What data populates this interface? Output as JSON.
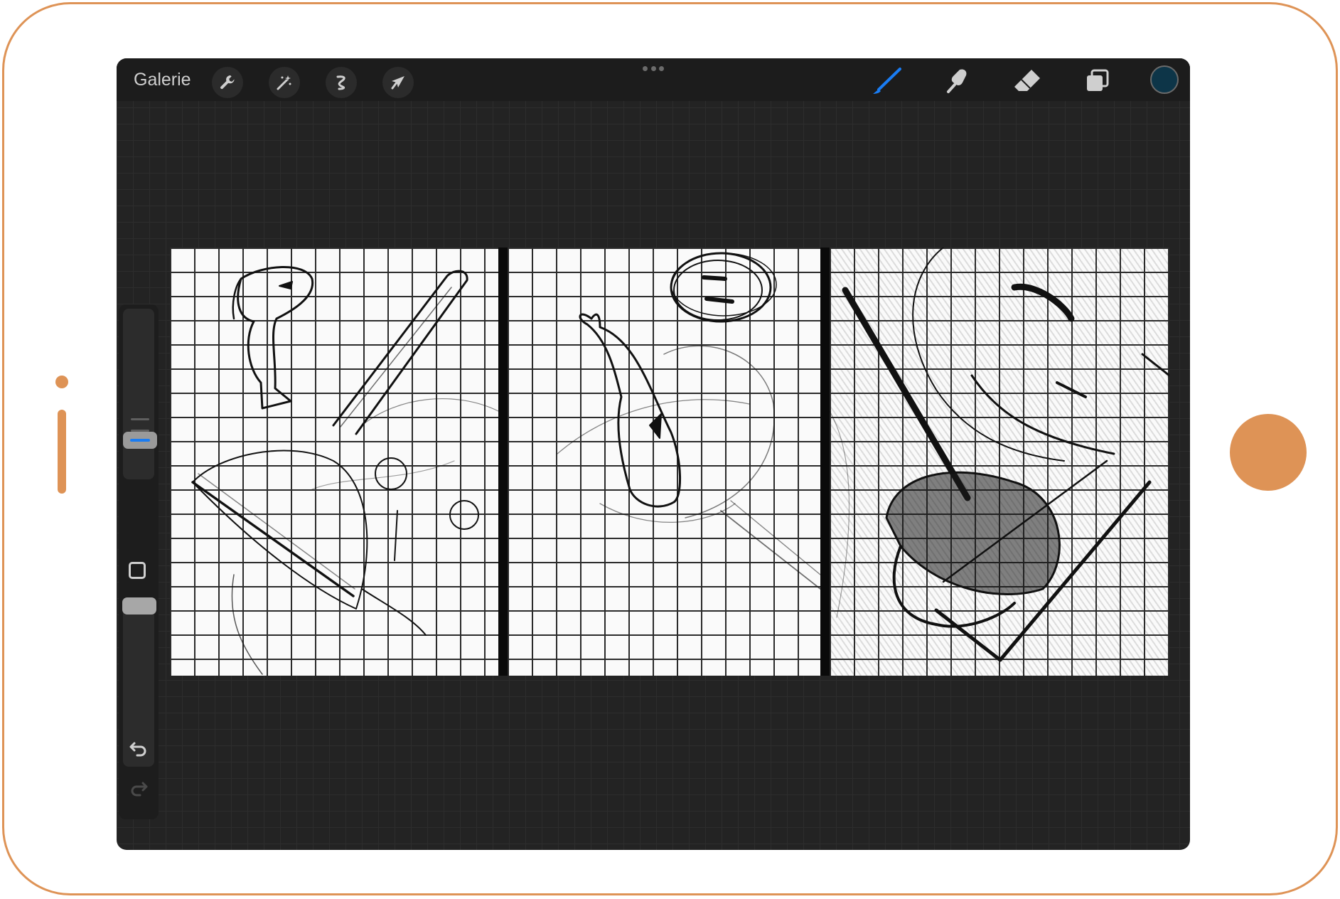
{
  "toolbar": {
    "gallery_label": "Galerie",
    "left_tools": [
      "wrench-icon",
      "magic-wand-icon",
      "selection-icon",
      "transform-arrow-icon"
    ],
    "right_tools": [
      "brush-icon",
      "smudge-icon",
      "eraser-icon",
      "layers-icon"
    ],
    "active_tool": "brush-icon",
    "current_color": "#0d3548",
    "accent_color": "#1a7cf2"
  },
  "sidebar": {
    "brush_size_level": 0.2,
    "opacity_level": 1.0,
    "modify_button_icon": "square-icon",
    "undo_icon": "undo-icon",
    "redo_icon": "redo-icon",
    "redo_enabled": false
  },
  "device": {
    "frame_color": "#de9356"
  },
  "canvas": {
    "panels": [
      "sketch-panel-1",
      "sketch-panel-2",
      "sketch-panel-3"
    ]
  }
}
